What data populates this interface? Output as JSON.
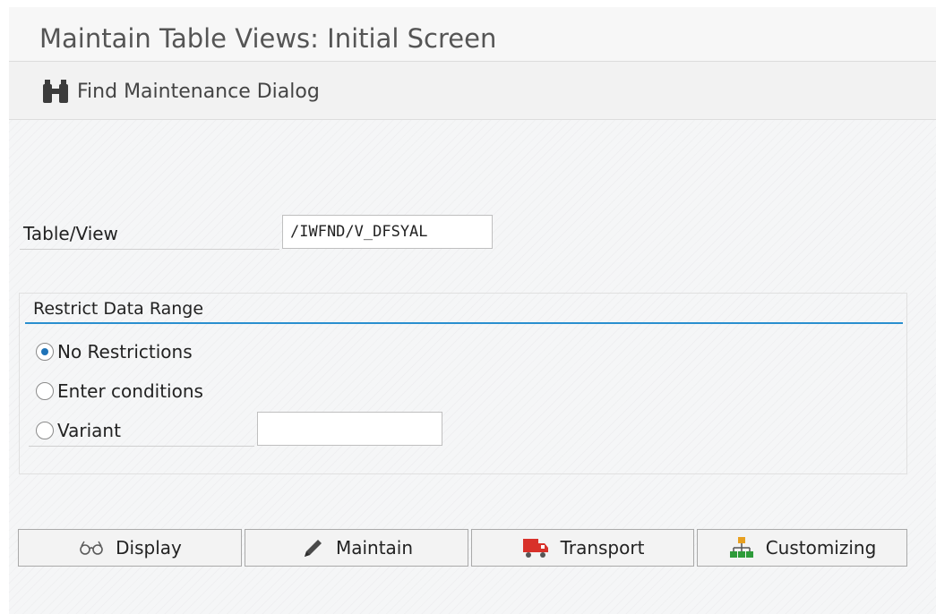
{
  "window": {
    "title": "Maintain Table Views: Initial Screen"
  },
  "toolbar": {
    "find_label": "Find Maintenance Dialog",
    "find_icon": "binoculars-icon"
  },
  "form": {
    "table_view_label": "Table/View",
    "table_view_value": "/IWFND/V_DFSYAL"
  },
  "restrict": {
    "title": "Restrict Data Range",
    "options": [
      {
        "label": "No Restrictions",
        "checked": true
      },
      {
        "label": "Enter conditions",
        "checked": false
      },
      {
        "label": "Variant",
        "checked": false
      }
    ],
    "variant_value": ""
  },
  "actions": {
    "display_label": "Display",
    "maintain_label": "Maintain",
    "transport_label": "Transport",
    "customizing_label": "Customizing",
    "display_icon": "glasses-icon",
    "maintain_icon": "pencil-icon",
    "transport_icon": "truck-icon",
    "customizing_icon": "hierarchy-icon"
  },
  "colors": {
    "accent_line": "#2a8fcf",
    "radio_selected": "#1f73b7",
    "truck_red": "#d8312a",
    "tree_orange": "#e8a020",
    "tree_green": "#2e9b3a"
  }
}
